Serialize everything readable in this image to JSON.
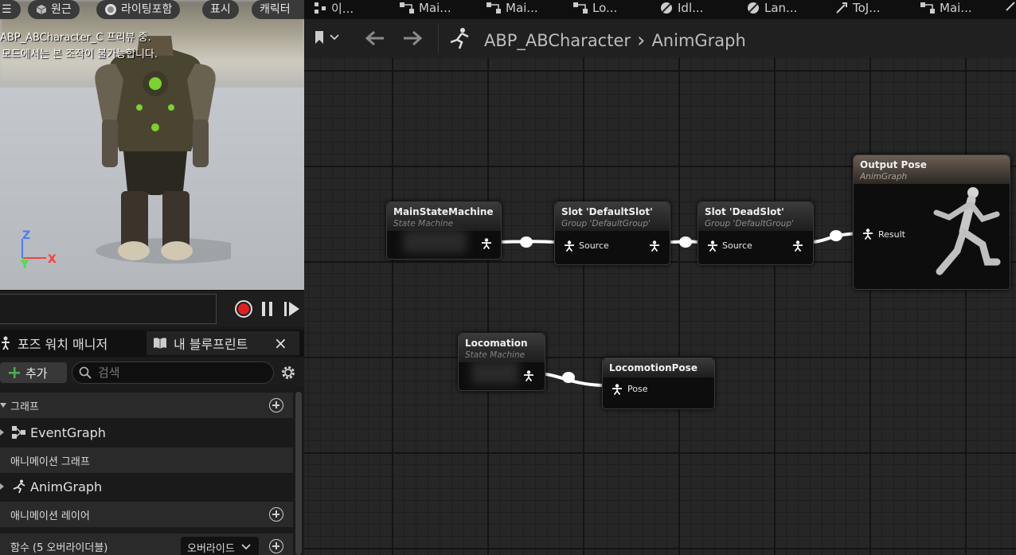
{
  "viewport": {
    "buttons": {
      "menu": "☰",
      "perspective": "원근",
      "lighting": "라이팅포함",
      "show": "표시",
      "character": "캐릭터"
    },
    "preview_title": "ABP_ABCharacter_C 프리뷰 중.",
    "preview_note": "이 모드에서는 본 조작이 불가능합니다.",
    "axes": {
      "z": "Z",
      "y": "Y",
      "x": "X"
    }
  },
  "panel_tabs": {
    "pose_watch": "포즈 워치 매니저",
    "my_blueprint": "내 블루프린트",
    "close": "×"
  },
  "toolbar": {
    "add_label": "추가",
    "search_placeholder": "검색"
  },
  "my_blueprint": {
    "graphs_section": "그래프",
    "event_graph": "EventGraph",
    "anim_graphs_section": "애니메이션 그래프",
    "anim_graph": "AnimGraph",
    "anim_layers_section": "애니메이션 레이어",
    "functions_section": "함수 (5 오버라이더블)",
    "override_label": "오버라이드"
  },
  "graph_tabs": [
    "이...",
    "Mai...",
    "Mai...",
    "Lo...",
    "Idl...",
    "Lan...",
    "ToJ...",
    "Mai..."
  ],
  "breadcrumb": {
    "asset": "ABP_ABCharacter",
    "separator": "›",
    "graph": "AnimGraph"
  },
  "nodes": {
    "main_state_machine": {
      "title": "MainStateMachine",
      "subtitle": "State Machine"
    },
    "slot_default": {
      "title": "Slot 'DefaultSlot'",
      "subtitle": "Group 'DefaultGroup'",
      "pin": "Source"
    },
    "slot_dead": {
      "title": "Slot 'DeadSlot'",
      "subtitle": "Group 'DefaultGroup'",
      "pin": "Source"
    },
    "output_pose": {
      "title": "Output Pose",
      "subtitle": "AnimGraph",
      "pin": "Result"
    },
    "locomation": {
      "title": "Locomation",
      "subtitle": "State Machine"
    },
    "locomotion_pose": {
      "title": "LocomotionPose",
      "pin": "Pose"
    }
  },
  "colors": {
    "wire": "#ffffff",
    "record": "#e02020",
    "add_plus": "#4caf50",
    "axis_x": "#ff3b3b",
    "axis_y": "#4ade4a",
    "axis_z": "#4a7cff"
  }
}
